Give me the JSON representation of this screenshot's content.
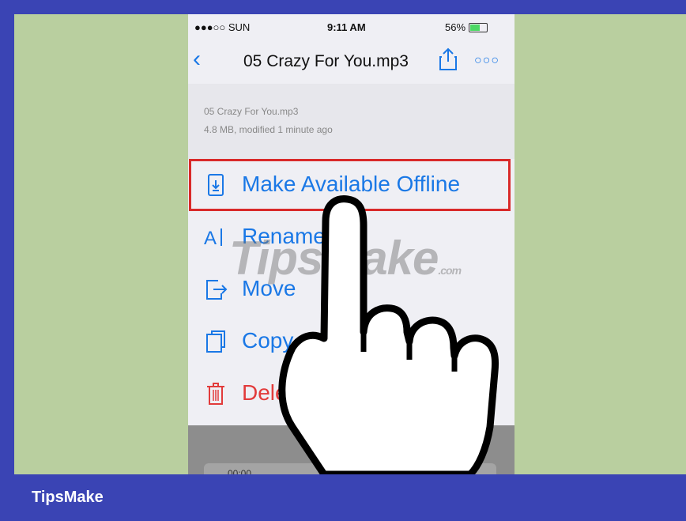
{
  "status_bar": {
    "carrier": "●●●○○ SUN",
    "time": "9:11 AM",
    "battery": "56%",
    "battery_level": 0.56
  },
  "nav": {
    "back_icon": "chevron-left",
    "title": "05 Crazy For You.mp3",
    "share_icon": "share",
    "more_icon": "ellipsis"
  },
  "file_info": {
    "name": "05 Crazy For You.mp3",
    "meta": "4.8 MB, modified 1 minute ago"
  },
  "menu": [
    {
      "label": "Make Available Offline",
      "icon": "download-icon"
    },
    {
      "label": "Rename",
      "icon": "rename-icon"
    },
    {
      "label": "Move",
      "icon": "move-icon"
    },
    {
      "label": "Copy",
      "icon": "copy-icon"
    },
    {
      "label": "Delete",
      "icon": "trash-icon"
    }
  ],
  "player": {
    "time": "00:00"
  },
  "watermark": {
    "main": "TipsMake",
    "suffix": ".com"
  },
  "footer": {
    "brand": "TipsMake"
  },
  "colors": {
    "accent": "#1a78e6",
    "delete": "#e23b3b",
    "highlight": "#d92a2a",
    "frame": "#3a44b4",
    "background": "#b9cf9f"
  }
}
